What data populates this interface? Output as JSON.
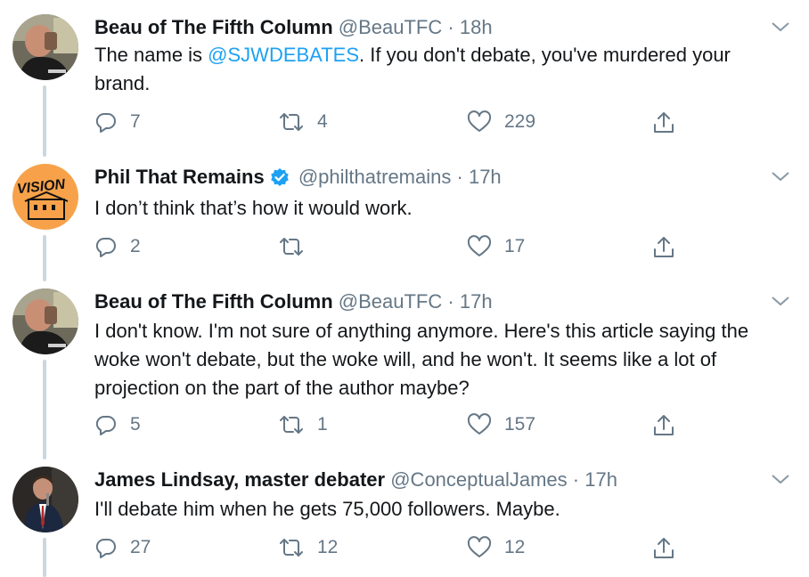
{
  "tweets": [
    {
      "name": "Beau of The Fifth Column",
      "handle": "@BeauTFC",
      "separator": "·",
      "time": "18h",
      "verified": false,
      "text_parts": [
        "The name is ",
        "@SJWDEBATES",
        ". If you don't debate, you've murdered your brand."
      ],
      "replies": "7",
      "retweets": "4",
      "likes": "229",
      "avatar_icon": "man-drinking-avatar"
    },
    {
      "name": "Phil That Remains",
      "handle": "@philthatremains",
      "separator": "·",
      "time": "17h",
      "verified": true,
      "text": "I don’t think that’s how it would work.",
      "replies": "2",
      "retweets": "",
      "likes": "17",
      "avatar_icon": "orange-vision-logo-avatar",
      "avatar_text": "VISION"
    },
    {
      "name": "Beau of The Fifth Column",
      "handle": "@BeauTFC",
      "separator": "·",
      "time": "17h",
      "verified": false,
      "text": "I don't know. I'm not sure of anything anymore. Here's this article saying the woke won't debate, but the woke will, and he won't. It seems like a lot of projection on the part of the author maybe?",
      "replies": "5",
      "retweets": "1",
      "likes": "157",
      "avatar_icon": "man-drinking-avatar"
    },
    {
      "name": "James Lindsay, master debater",
      "handle": "@ConceptualJames",
      "separator": "·",
      "time": "17h",
      "verified": false,
      "text": "I'll debate him when he gets 75,000 followers. Maybe.",
      "replies": "27",
      "retweets": "12",
      "likes": "12",
      "avatar_icon": "man-speaking-avatar"
    }
  ],
  "colors": {
    "text": "#14171a",
    "secondary": "#657786",
    "link": "#1da1f2",
    "thread_line": "#ccd6dd",
    "verified": "#1da1f2"
  }
}
